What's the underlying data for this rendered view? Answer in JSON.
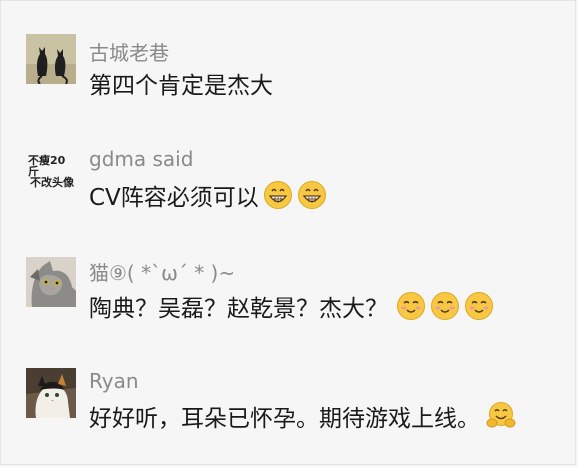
{
  "comments": [
    {
      "name": "古城老巷",
      "text": "第四个肯定是杰大",
      "emojis": [],
      "avatar": {
        "type": "image",
        "icon": "two-cats-silhouette-avatar"
      }
    },
    {
      "name": "gdma said",
      "text": "CV阵容必须可以",
      "emojis": [
        "grinning-face-icon",
        "grinning-face-icon"
      ],
      "avatar": {
        "type": "text",
        "line1": "不瘦20斤",
        "line2": "不改头像"
      }
    },
    {
      "name": "猫⑨( *`ω´ * )~",
      "text": "陶典？吴磊？赵乾景？杰大？",
      "emojis": [
        "smiling-face-icon",
        "smiling-face-icon",
        "smiling-face-icon"
      ],
      "avatar": {
        "type": "image",
        "icon": "gray-cat-avatar"
      }
    },
    {
      "name": "Ryan",
      "text": "好好听，耳朵已怀孕。期待游戏上线。",
      "emojis": [
        "hug-face-icon"
      ],
      "avatar": {
        "type": "image",
        "icon": "calico-cat-avatar"
      }
    }
  ]
}
